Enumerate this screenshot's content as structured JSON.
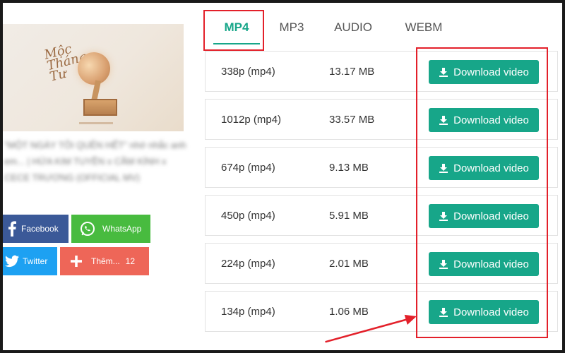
{
  "thumbnail": {
    "title_text": "Mộc Tháng Tư"
  },
  "video": {
    "title": "\"MỘT NGÀY TÔI QUÊN HẾT\" nhớ nhắc anh em... | HỨA KIM TUYỀN x CẦM KÍNH x CECE TRƯƠNG (OFFICIAL MV)"
  },
  "share": {
    "facebook": "Facebook",
    "whatsapp": "WhatsApp",
    "twitter": "Twitter",
    "more": "Thêm...",
    "more_count": "12"
  },
  "tabs": [
    {
      "label": "MP4",
      "active": true
    },
    {
      "label": "MP3"
    },
    {
      "label": "AUDIO"
    },
    {
      "label": "WEBM"
    }
  ],
  "rows": [
    {
      "quality": "338p (mp4)",
      "size": "13.17 MB",
      "button": "Download video"
    },
    {
      "quality": "1012p (mp4)",
      "size": "33.57 MB",
      "button": "Download video"
    },
    {
      "quality": "674p (mp4)",
      "size": "9.13 MB",
      "button": "Download video"
    },
    {
      "quality": "450p (mp4)",
      "size": "5.91 MB",
      "button": "Download video"
    },
    {
      "quality": "224p (mp4)",
      "size": "2.01 MB",
      "button": "Download video"
    },
    {
      "quality": "134p (mp4)",
      "size": "1.06 MB",
      "button": "Download video"
    }
  ],
  "colors": {
    "accent": "#17a689",
    "highlight": "#e3202a",
    "facebook": "#3b5998",
    "whatsapp": "#48bb3f",
    "twitter": "#1da1f2",
    "more": "#ee6658"
  }
}
